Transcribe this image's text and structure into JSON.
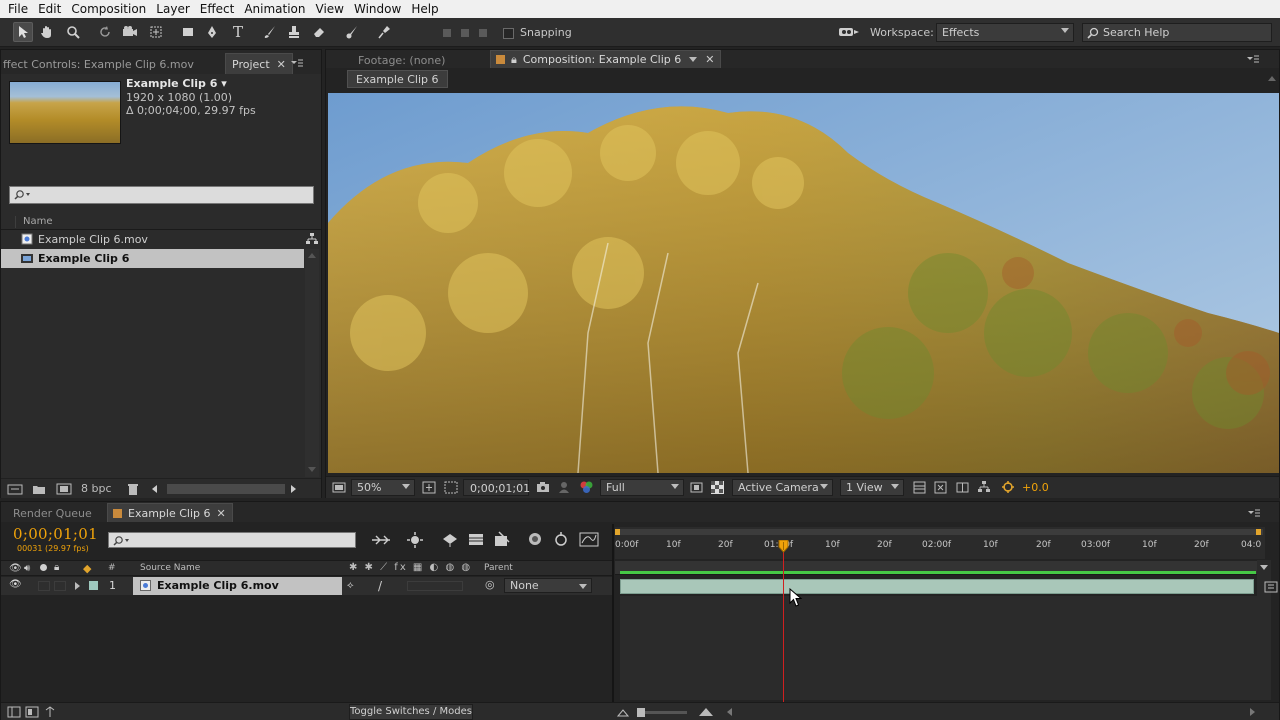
{
  "menu": [
    "File",
    "Edit",
    "Composition",
    "Layer",
    "Effect",
    "Animation",
    "View",
    "Window",
    "Help"
  ],
  "toolbar": {
    "snapping_label": "Snapping",
    "workspace_label": "Workspace:",
    "workspace_value": "Effects",
    "search_help_placeholder": "Search Help"
  },
  "project_panel": {
    "tab_effect_controls": "ffect Controls: Example Clip 6.mov",
    "tab_project": "Project",
    "item_name": "Example Clip 6 ▾",
    "item_resolution": "1920 x 1080 (1.00)",
    "item_duration": "Δ 0;00;04;00, 29.97 fps",
    "search_placeholder": "",
    "column_name": "Name",
    "items": [
      {
        "label": "Example Clip 6.mov",
        "type": "footage"
      },
      {
        "label": "Example Clip 6",
        "type": "composition"
      }
    ],
    "bpc": "8 bpc"
  },
  "composition_panel": {
    "tab_footage": "Footage: (none)",
    "tab_composition": "Composition: Example Clip 6",
    "breadcrumb": "Example Clip 6",
    "zoom": "50%",
    "timecode": "0;00;01;01",
    "resolution": "Full",
    "camera": "Active Camera",
    "views": "1 View",
    "exposure": "+0.0"
  },
  "timeline": {
    "tab_render_queue": "Render Queue",
    "tab_comp": "Example Clip 6",
    "current_time": "0;00;01;01",
    "frame_info": "00031 (29.97 fps)",
    "search_placeholder": "",
    "col_source_name": "Source Name",
    "col_parent": "Parent",
    "col_number": "#",
    "layers": [
      {
        "number": "1",
        "name": "Example Clip 6.mov",
        "parent": "None"
      }
    ],
    "toggle_label": "Toggle Switches / Modes",
    "ruler_labels": [
      "0:00f",
      "10f",
      "20f",
      "01:00f",
      "10f",
      "20f",
      "02:00f",
      "10f",
      "20f",
      "03:00f",
      "10f",
      "20f",
      "04:0"
    ]
  },
  "colors": {
    "accent_orange": "#f0a30a",
    "playhead_red": "#d02020",
    "layer_bar": "#a9c7b9",
    "work_area_green": "#46c846",
    "sky": "#8fb3db"
  }
}
